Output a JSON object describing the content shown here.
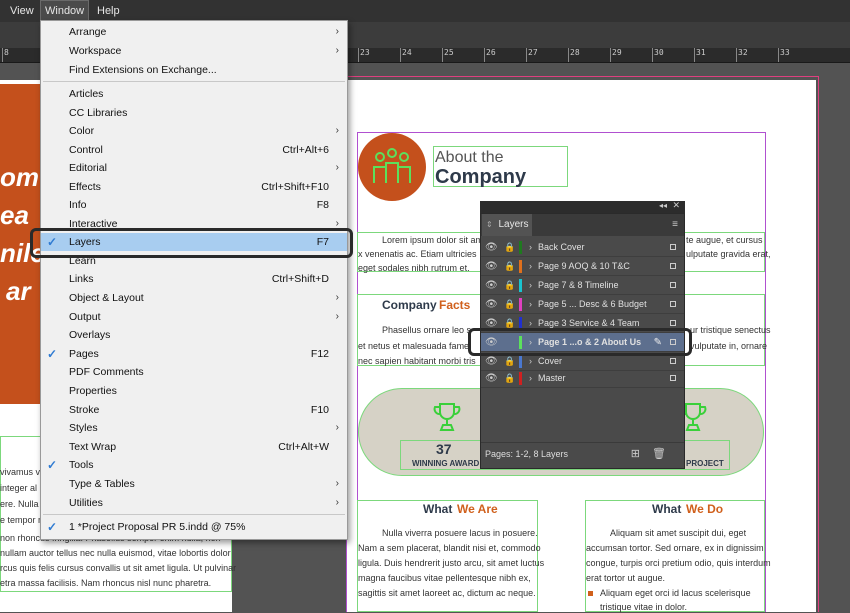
{
  "menubar": {
    "view": "View",
    "window": "Window",
    "help": "Help"
  },
  "ruler": {
    "ticks": [
      "8",
      "23",
      "24",
      "25",
      "26",
      "27",
      "28",
      "29",
      "30",
      "31",
      "32",
      "33"
    ]
  },
  "window_menu": {
    "arrange": "Arrange",
    "workspace": "Workspace",
    "find_extensions": "Find Extensions on Exchange...",
    "articles": "Articles",
    "cc_libraries": "CC Libraries",
    "color": "Color",
    "control": "Control",
    "control_sc": "Ctrl+Alt+6",
    "editorial": "Editorial",
    "effects": "Effects",
    "effects_sc": "Ctrl+Shift+F10",
    "info": "Info",
    "info_sc": "F8",
    "interactive": "Interactive",
    "layers": "Layers",
    "layers_sc": "F7",
    "learn": "Learn",
    "links": "Links",
    "links_sc": "Ctrl+Shift+D",
    "object_layout": "Object & Layout",
    "output": "Output",
    "overlays": "Overlays",
    "pages": "Pages",
    "pages_sc": "F12",
    "pdf_comments": "PDF Comments",
    "properties": "Properties",
    "stroke": "Stroke",
    "stroke_sc": "F10",
    "styles": "Styles",
    "text_wrap": "Text Wrap",
    "text_wrap_sc": "Ctrl+Alt+W",
    "tools": "Tools",
    "type_tables": "Type & Tables",
    "utilities": "Utilities",
    "open_doc": "1 *Project Proposal PR 5.indd @ 75%"
  },
  "layers_panel": {
    "tab": "Layers",
    "footer": "Pages: 1-2, 8 Layers",
    "rows": [
      {
        "name": "Back Cover",
        "color": "#1f7a1f"
      },
      {
        "name": "Page 9 AOQ & 10 T&C",
        "color": "#e0701c"
      },
      {
        "name": "Page 7 & 8 Timeline",
        "color": "#19c4d0"
      },
      {
        "name": "Page 5 ... Desc & 6 Budget",
        "color": "#e040c0"
      },
      {
        "name": "Page 3 Service & 4 Team",
        "color": "#2030d0"
      },
      {
        "name": "Page 1 ...o & 2 About Us",
        "color": "#5ce05c"
      },
      {
        "name": "Cover",
        "color": "#4a78d0"
      },
      {
        "name": "Master",
        "color": "#d02020"
      }
    ]
  },
  "document": {
    "about_the": "About the",
    "company": "Company",
    "lorem1": "Lorem ipsum dolor sit am",
    "lorem1_right": "te augue, et cursus",
    "para1b": "x venenatis ac. Etiam ultricies",
    "para1b_right": "ulputate gravida erat,",
    "para1c": "eget sodales nibh rutrum et.",
    "company_facts_1": "Company",
    "company_facts_2": "Facts",
    "phasellus": "Phasellus ornare leo s",
    "phasellus_right": "ur tristique senectus",
    "para2b": "et netus et malesuada fame",
    "para2b_right": "vulputate in, ornare",
    "para2c": "nec sapien habitant morbi tris",
    "award_number": "37",
    "award_label": "WINNING AWARD",
    "project_label": "PROJECT",
    "what_we_are_1": "What",
    "what_we_are_2": "We Are",
    "what_we_do_1": "What",
    "what_we_do_2": "We Do",
    "wa1": "Nulla viverra posuere lacus in posuere.",
    "wa2": "Nam a sem placerat, blandit nisi et, commodo",
    "wa3": "ligula. Duis hendrerit justo arcu, sit amet luctus",
    "wa4": "magna faucibus vitae pellentesque nibh ex,",
    "wa5": "sagittis sit amet laoreet ac, dictum ac neque.",
    "wd1": "Aliquam sit amet suscipit dui, eget",
    "wd2": "accumsan tortor. Sed ornare, ex in dignissim",
    "wd3": "congue, turpis orci pretium odio, quis interdum",
    "wd4": "erat tortor ut augue.",
    "wd5": "Aliquam eget orci id lacus scelerisque",
    "wd6": "tristique vitae in dolor.",
    "left1": "vivamus vo",
    "left2": "integer al",
    "left3": "ere. Nulla",
    "left4": "e tempor n",
    "left5": "non rhoncus fringilla. Phasellus semper enim nulla, non",
    "left6": "nullam auctor tellus nec nulla euismod, vitae lobortis dolor",
    "left7": "rcus quis felis cursus convallis ut sit amet ligula. Ut pulvinar",
    "left8": "etra massa facilisis. Nam rhoncus nisl nunc pharetra.",
    "big1": "om",
    "big2": "ea",
    "big3": "nile",
    "big4": "ar"
  }
}
